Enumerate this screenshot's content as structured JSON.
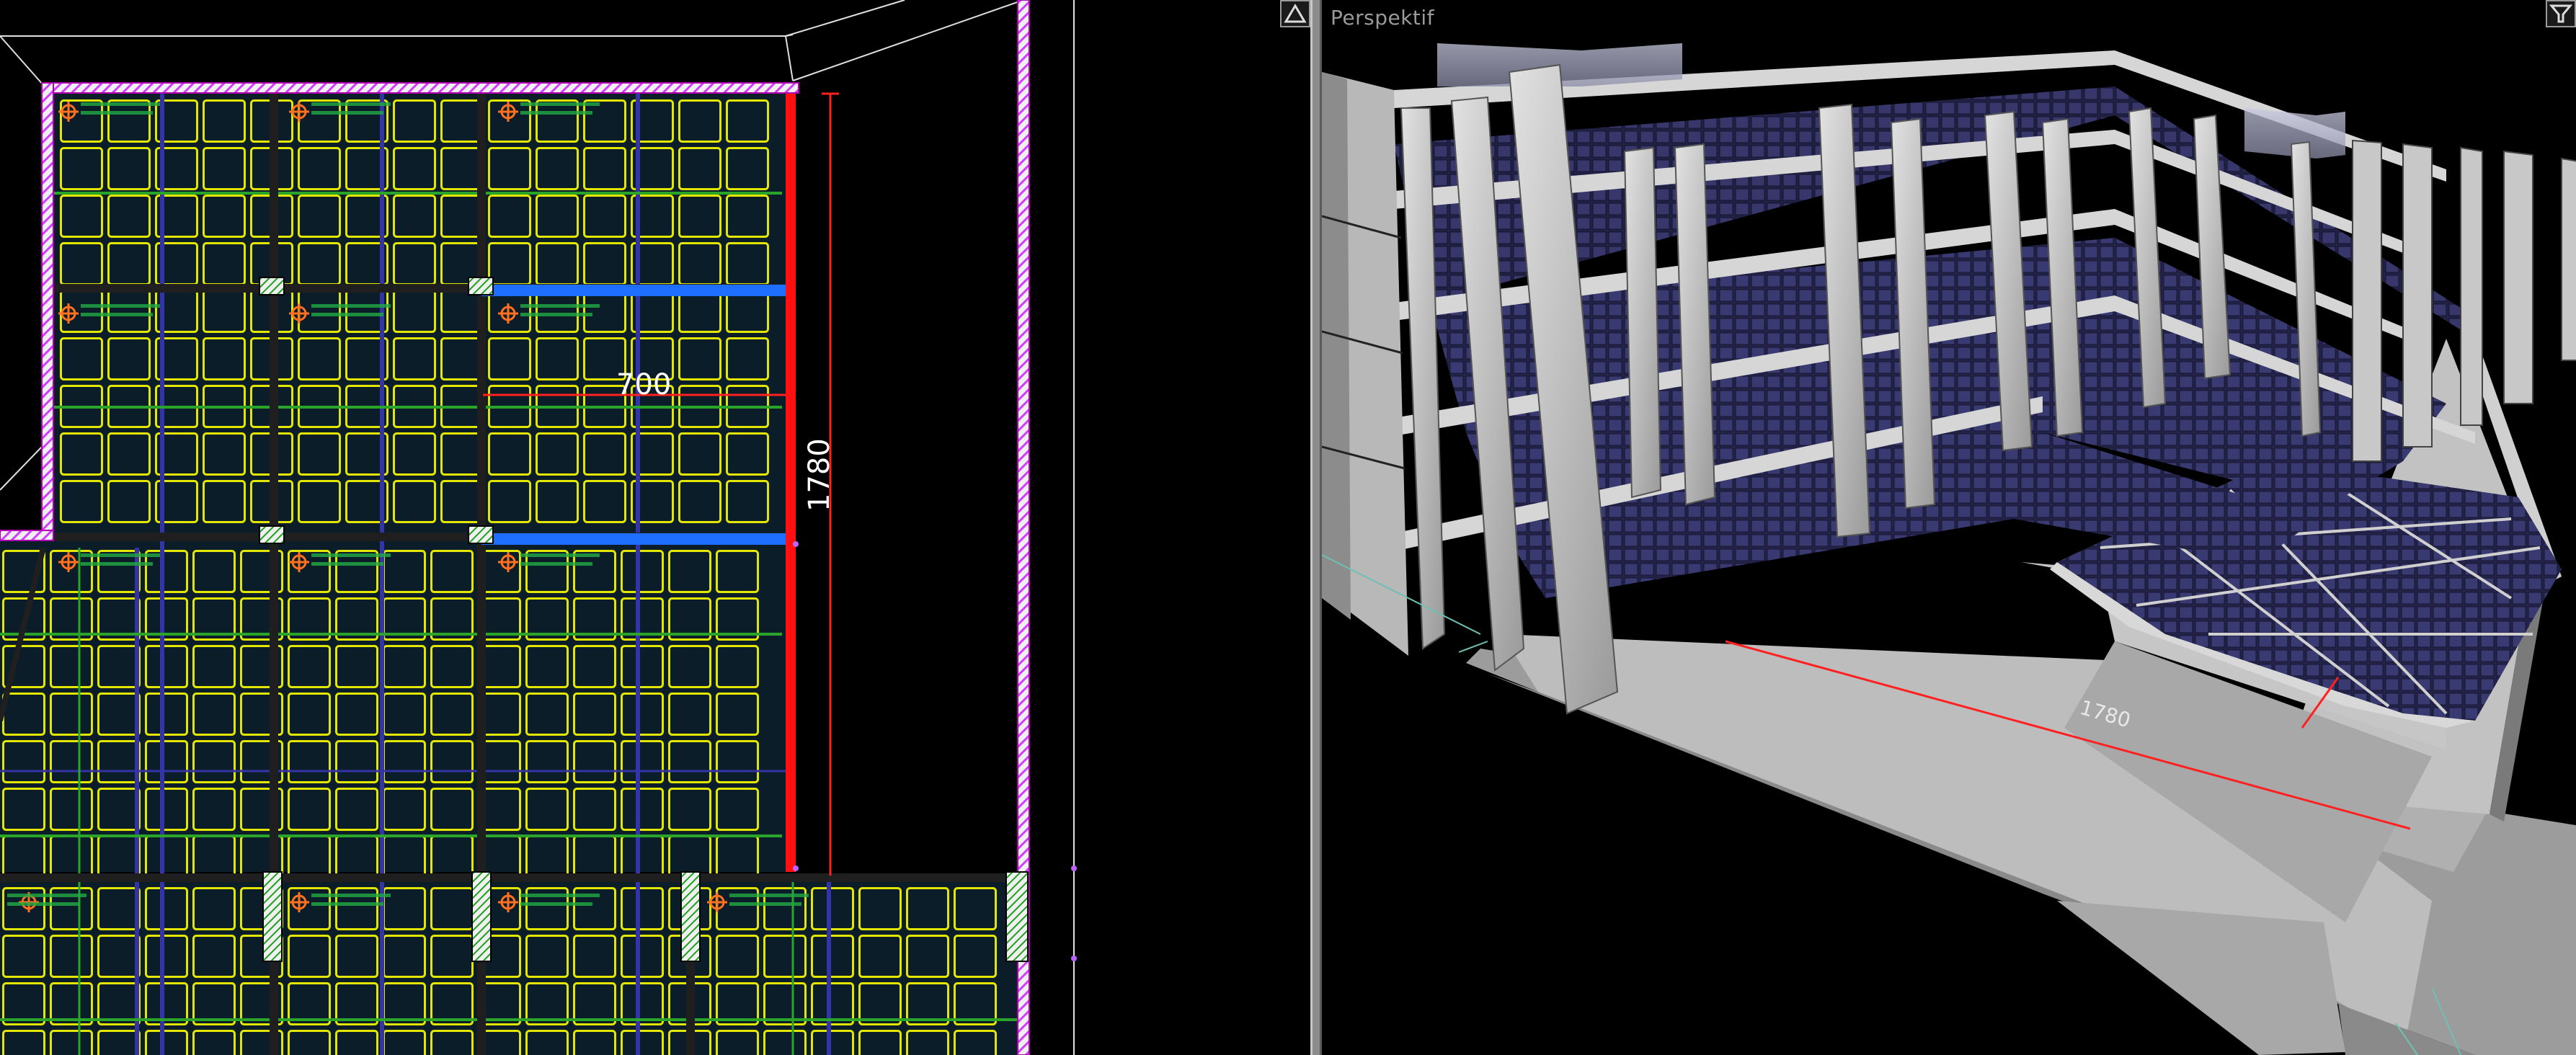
{
  "plan_view": {
    "dimension_horizontal": "700",
    "dimension_vertical": "1780",
    "maximize_icon": "triangle-up-icon"
  },
  "perspective_view": {
    "title": "Perspektif",
    "dimension_label": "1780",
    "maximize_icon": "funnel-icon"
  },
  "colors": {
    "background": "#000000",
    "slab_fill": "#0a1e2a",
    "grid_lines": "#e6e600",
    "beam_dark": "#202020",
    "blue_beam": "#1e6eff",
    "red_beam": "#ff1010",
    "wall_hatch": "#e23cff",
    "green_lines": "#2ea02e",
    "purple_lines": "#3535a0",
    "concrete": "#c4c4c4",
    "solar_panel": "#2a2a52"
  }
}
